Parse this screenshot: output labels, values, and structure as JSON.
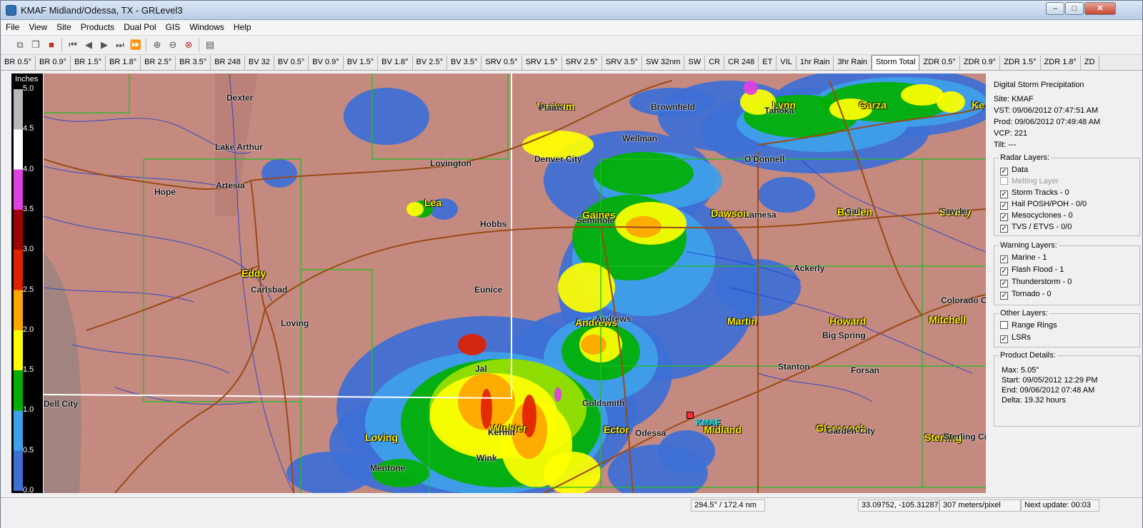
{
  "window": {
    "title": "KMAF Midland/Odessa, TX - GRLevel3",
    "minimize": "–",
    "maximize": "□",
    "close": "✕"
  },
  "menu": [
    "File",
    "View",
    "Site",
    "Products",
    "Dual Pol",
    "GIS",
    "Windows",
    "Help"
  ],
  "toolbar_icons": [
    "copy-icon",
    "save-icon",
    "loop-first-icon",
    "step-back-icon",
    "play-icon",
    "step-forward-icon",
    "loop-last-icon",
    "zoom-in-icon",
    "zoom-out-icon",
    "zoom-reset-icon",
    "layer-icon"
  ],
  "tabs": [
    "BR 0.5°",
    "BR 0.9°",
    "BR 1.5°",
    "BR 1.8°",
    "BR 2.5°",
    "BR 3.5°",
    "BR 248",
    "BV 32",
    "BV 0.5°",
    "BV 0.9°",
    "BV 1.5°",
    "BV 1.8°",
    "BV 2.5°",
    "BV 3.5°",
    "SRV 0.5°",
    "SRV 1.5°",
    "SRV 2.5°",
    "SRV 3.5°",
    "SW 32nm",
    "SW",
    "CR",
    "CR 248",
    "ET",
    "VIL",
    "1hr Rain",
    "3hr Rain",
    "Storm Total",
    "ZDR 0.5°",
    "ZDR 0.9°",
    "ZDR 1.5°",
    "ZDR 1.8°",
    "ZD"
  ],
  "active_tab": "Storm Total",
  "legend": {
    "title": "Inches",
    "ticks": [
      "5.0",
      "4.5",
      "4.0",
      "3.5",
      "3.0",
      "2.5",
      "2.0",
      "1.5",
      "1.0",
      "0.5",
      "0.0"
    ],
    "colors": [
      "#4a78d8",
      "#3aa3e8",
      "#00b000",
      "#70d800",
      "#ffff00",
      "#ffb000",
      "#e03000",
      "#b00000",
      "#a000a0",
      "#e040e0",
      "#ffffff",
      "#b0b0b0"
    ]
  },
  "map": {
    "counties": [
      "Yoakum",
      "Lea",
      "Gaines",
      "Dawson",
      "Borden",
      "Scurry",
      "Eddy",
      "Andrews",
      "Martin",
      "Howard",
      "Mitchell",
      "Loving",
      "Winkler",
      "Ector",
      "Midland",
      "Glasscock",
      "Sterling",
      "Garza",
      "Lynn",
      "Ke"
    ],
    "cities": [
      "Dexter",
      "Lake Arthur",
      "Hope",
      "Artesia",
      "Carlsbad",
      "Loving",
      "Dell City",
      "Lovington",
      "Hobbs",
      "Eunice",
      "Jal",
      "Kermit",
      "Wink",
      "Mentone",
      "Goldsmith",
      "Odessa",
      "Denver City",
      "Plains",
      "Wellman",
      "Brownfield",
      "Tahoka",
      "O'Donnell",
      "Lamesa",
      "Gail",
      "Snyder",
      "Ackerly",
      "Colorado City",
      "Big Spring",
      "Stanton",
      "Forsan",
      "Garden City",
      "Sterling City",
      "Seminole",
      "Andrews"
    ],
    "site_label": "KMAF"
  },
  "panel": {
    "title": "Digital Storm Precipitation",
    "site": "Site:  KMAF",
    "vst": "VST:  09/06/2012  07:47:51 AM",
    "prod": "Prod: 09/06/2012  07:49:48 AM",
    "vcp": "VCP:  221",
    "tilt": "Tilt:   ---",
    "radar_layers": {
      "label": "Radar Layers:",
      "items": [
        {
          "label": "Data",
          "checked": true,
          "dim": false
        },
        {
          "label": "Melting Layer",
          "checked": false,
          "dim": true
        },
        {
          "label": "Storm Tracks - 0",
          "checked": true,
          "dim": false
        },
        {
          "label": "Hail POSH/POH - 0/0",
          "checked": true,
          "dim": false
        },
        {
          "label": "Mesocyclones - 0",
          "checked": true,
          "dim": false
        },
        {
          "label": "TVS / ETVS - 0/0",
          "checked": true,
          "dim": false
        }
      ]
    },
    "warning_layers": {
      "label": "Warning Layers:",
      "items": [
        {
          "label": "Marine - 1",
          "checked": true
        },
        {
          "label": "Flash Flood - 1",
          "checked": true
        },
        {
          "label": "Thunderstorm - 0",
          "checked": true
        },
        {
          "label": "Tornado - 0",
          "checked": true
        }
      ]
    },
    "other_layers": {
      "label": "Other Layers:",
      "items": [
        {
          "label": "Range Rings",
          "checked": false
        },
        {
          "label": "LSRs",
          "checked": true
        }
      ]
    },
    "details": {
      "label": "Product Details:",
      "max": "Max:      5.05\"",
      "start": "Start:     09/05/2012  12:29 PM",
      "end": "End:       09/06/2012  07:48 AM",
      "delta": "Delta:     19.32 hours"
    }
  },
  "status": {
    "azimuth_range": "294.5° / 172.4 nm",
    "latlon": "33.09752, -105.31287",
    "scale": "307 meters/pixel",
    "next_update": "Next update: 00:03"
  }
}
